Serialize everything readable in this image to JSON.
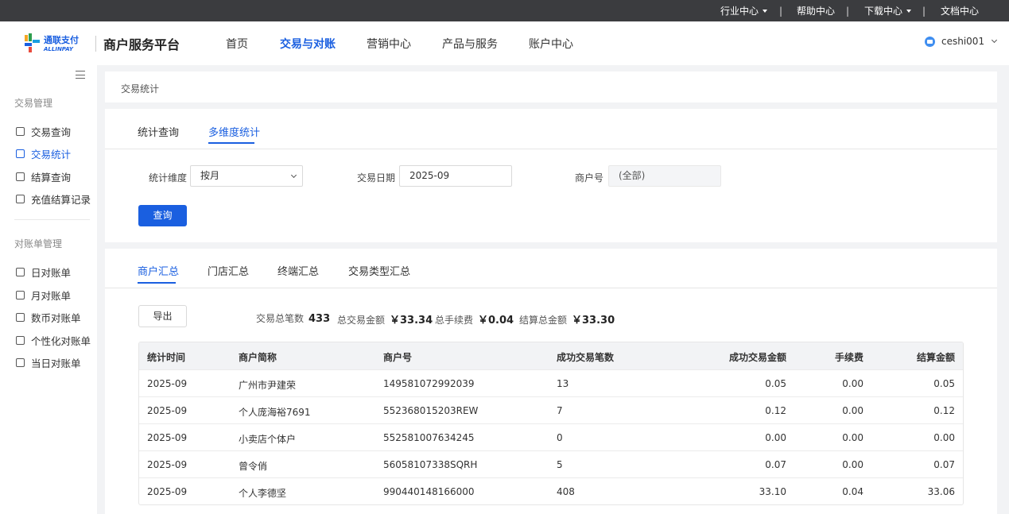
{
  "topbar": {
    "industry": "行业中心",
    "help": "帮助中心",
    "download": "下载中心",
    "docs": "文档中心",
    "separator": "|"
  },
  "header": {
    "logo_text_cn": "通联支付",
    "logo_text_en": "ALLINPAY",
    "brand": "商户服务平台",
    "nav": [
      "首页",
      "交易与对账",
      "营销中心",
      "产品与服务",
      "账户中心"
    ],
    "active_nav": "交易与对账",
    "username": "ceshi001"
  },
  "sidebar": {
    "group1": "交易管理",
    "items1": [
      "交易查询",
      "交易统计",
      "结算查询",
      "充值结算记录"
    ],
    "group2": "对账单管理",
    "items2": [
      "日对账单",
      "月对账单",
      "数币对账单",
      "个性化对账单",
      "当日对账单"
    ],
    "active_item": "交易统计"
  },
  "breadcrumb": "交易统计",
  "query_tabs": [
    "统计查询",
    "多维度统计"
  ],
  "filters": {
    "dimension_label": "统计维度",
    "dimension_value": "按月",
    "date_label": "交易日期",
    "date_value": "2025-09",
    "merchant_label": "商户号",
    "merchant_value": "(全部)",
    "query_button": "查询"
  },
  "summary_tabs": [
    "商户汇总",
    "门店汇总",
    "终端汇总",
    "交易类型汇总"
  ],
  "export_button": "导出",
  "stats": {
    "count_label": "交易总笔数",
    "count_value": "433",
    "amount_label": "总交易金额",
    "amount_value": "￥33.34",
    "fee_label": "总手续费",
    "fee_value": "￥0.04",
    "settle_label": "结算总金额",
    "settle_value": "￥33.30"
  },
  "table": {
    "columns": [
      "统计时间",
      "商户简称",
      "商户号",
      "成功交易笔数",
      "成功交易金额",
      "手续费",
      "结算金额"
    ],
    "rows": [
      [
        "2025-09",
        "广州市尹建荣",
        "149581072992039",
        "13",
        "0.05",
        "0.00",
        "0.05"
      ],
      [
        "2025-09",
        "个人庞海裕7691",
        "552368015203REW",
        "7",
        "0.12",
        "0.00",
        "0.12"
      ],
      [
        "2025-09",
        "小卖店个体户",
        "552581007634245",
        "0",
        "0.00",
        "0.00",
        "0.00"
      ],
      [
        "2025-09",
        "曾令俏",
        "56058107338SQRH",
        "5",
        "0.07",
        "0.00",
        "0.07"
      ],
      [
        "2025-09",
        "个人李德坚",
        "990440148166000",
        "408",
        "33.10",
        "0.04",
        "33.06"
      ]
    ]
  },
  "colors": {
    "accent": "#1a5fe0",
    "topbar": "#3b3c3f"
  }
}
